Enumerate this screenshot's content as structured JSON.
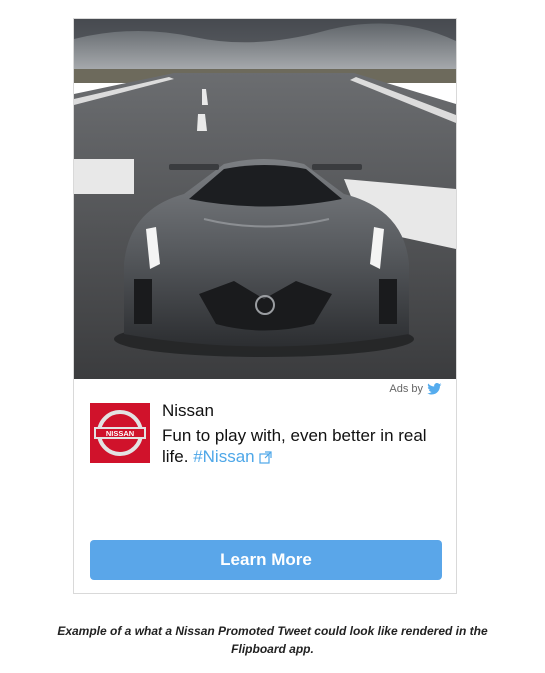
{
  "card": {
    "ads_by_label": "Ads by",
    "brand_name": "Nissan",
    "logo_text": "NISSAN",
    "tweet_text": "Fun to play with, even better in real life.",
    "hashtag": "#Nissan",
    "cta_label": "Learn More"
  },
  "caption": {
    "line1": "Example of a what a Nissan Promoted Tweet could look like rendered in the",
    "line2": "Flipboard app."
  },
  "colors": {
    "cta": "#5aa6e9",
    "hashtag": "#4ea7e8",
    "brand_logo_bg": "#d0122b"
  }
}
